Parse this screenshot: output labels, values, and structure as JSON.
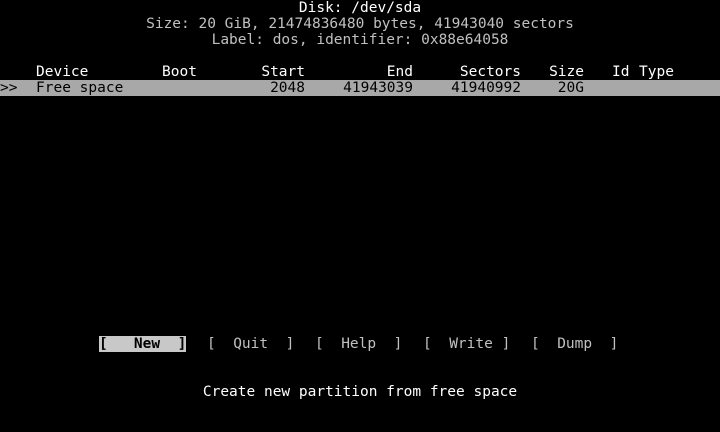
{
  "disk": {
    "title": "Disk: /dev/sda",
    "size_line": "Size: 20 GiB, 21474836480 bytes, 41943040 sectors",
    "label_line": "Label: dos, identifier: 0x88e64058"
  },
  "table": {
    "headers": {
      "device": "Device",
      "boot": "Boot",
      "start": "Start",
      "end": "End",
      "sectors": "Sectors",
      "size": "Size",
      "id": "Id",
      "type": "Type"
    },
    "rows": [
      {
        "cursor": ">>",
        "device": "Free space",
        "boot": "",
        "start": "2048",
        "end": "41943039",
        "sectors": "41940992",
        "size": "20G",
        "id": "",
        "type": ""
      }
    ]
  },
  "menu": {
    "items": [
      {
        "label": "[   New  ]",
        "selected": true
      },
      {
        "label": "[  Quit  ]",
        "selected": false
      },
      {
        "label": "[  Help  ]",
        "selected": false
      },
      {
        "label": "[  Write ]",
        "selected": false
      },
      {
        "label": "[  Dump  ]",
        "selected": false
      }
    ]
  },
  "hint": "Create new partition from free space",
  "colors": {
    "background": "#000000",
    "text": "#c0c0c0",
    "highlight_bg": "#a8a8a8",
    "highlight_text": "#000000"
  }
}
